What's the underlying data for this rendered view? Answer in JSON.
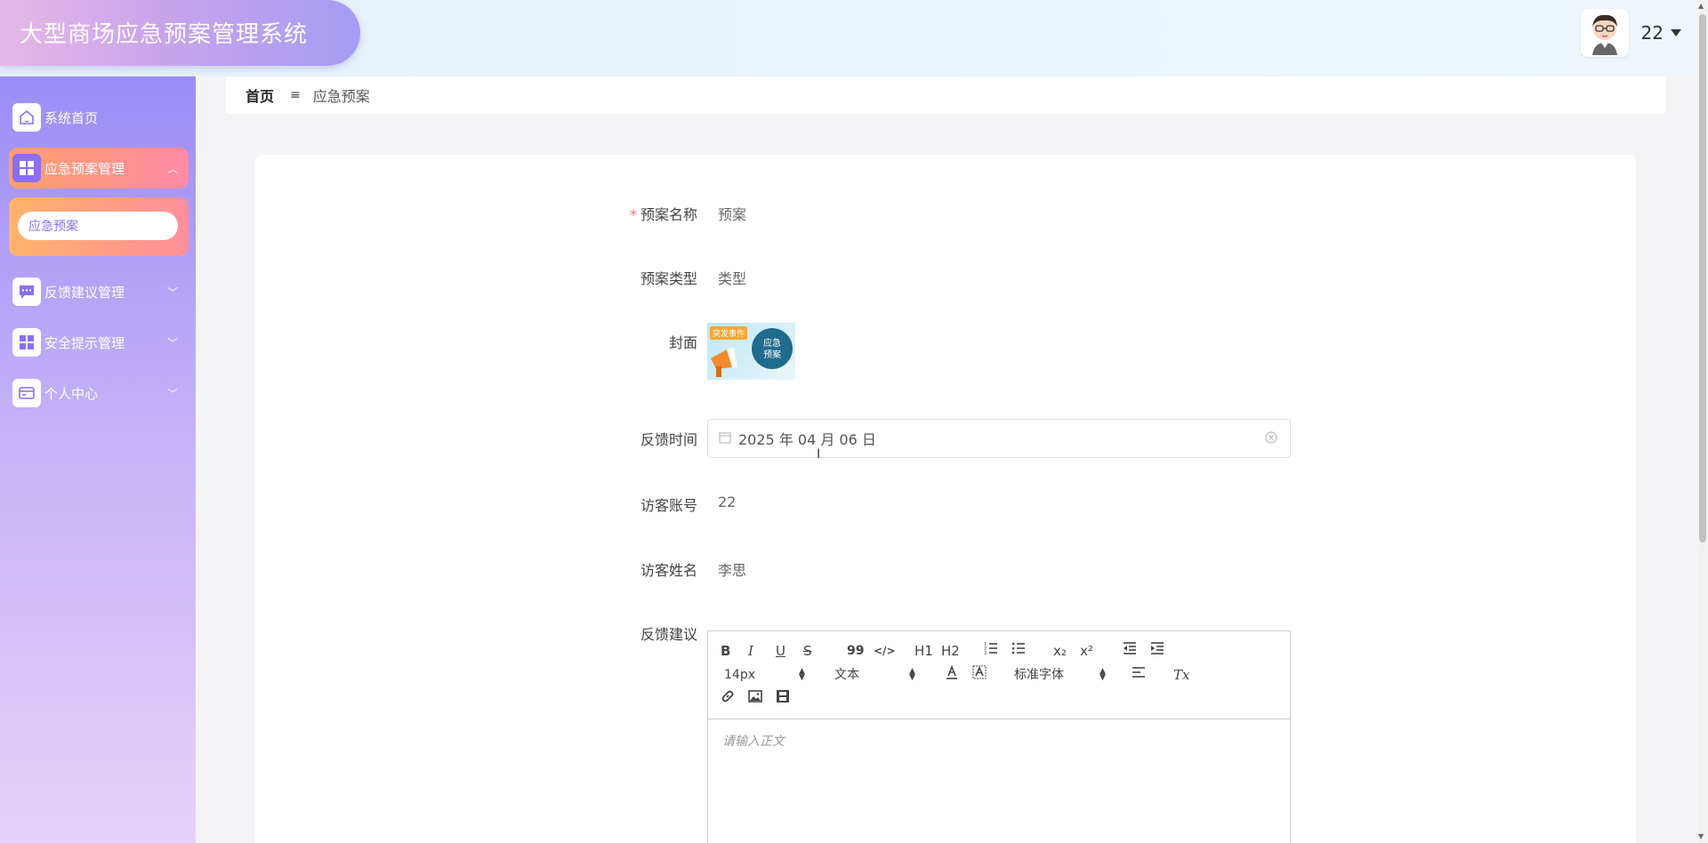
{
  "app": {
    "title": "大型商场应急预案管理系统"
  },
  "user": {
    "name": "22"
  },
  "sidebar": {
    "items": [
      {
        "label": "系统首页",
        "icon": "home-icon"
      },
      {
        "label": "应急预案管理",
        "icon": "grid-icon",
        "expanded": true
      },
      {
        "label": "反馈建议管理",
        "icon": "chat-icon"
      },
      {
        "label": "安全提示管理",
        "icon": "grid-icon"
      },
      {
        "label": "个人中心",
        "icon": "card-icon"
      }
    ],
    "submenu": {
      "label": "应急预案"
    }
  },
  "breadcrumb": {
    "home": "首页",
    "separator": "≡",
    "current": "应急预案"
  },
  "form": {
    "name_label": "预案名称",
    "name_value": "预案",
    "type_label": "预案类型",
    "type_value": "类型",
    "cover_label": "封面",
    "cover_badge": "突发事件",
    "cover_bubble_line1": "应急",
    "cover_bubble_line2": "预案",
    "date_label": "反馈时间",
    "date_value": "2025 年 04 月 06 日",
    "account_label": "访客账号",
    "account_value": "22",
    "visitor_name_label": "访客姓名",
    "visitor_name_value": "李思",
    "feedback_label": "反馈建议"
  },
  "editor": {
    "font_size": "14px",
    "heading": "文本",
    "font_family": "标准字体",
    "placeholder": "请输入正文",
    "buttons": {
      "bold": "B",
      "italic": "I",
      "underline": "U",
      "strike": "S",
      "quote": "99",
      "code": "</>",
      "h1": "H1",
      "h2": "H2",
      "subscript": "x₂",
      "superscript": "x²",
      "clean": "Tx"
    }
  },
  "colors": {
    "accent": "#8c6ff2",
    "active_menu": "#ff9f6a",
    "required": "#f56c6c"
  }
}
